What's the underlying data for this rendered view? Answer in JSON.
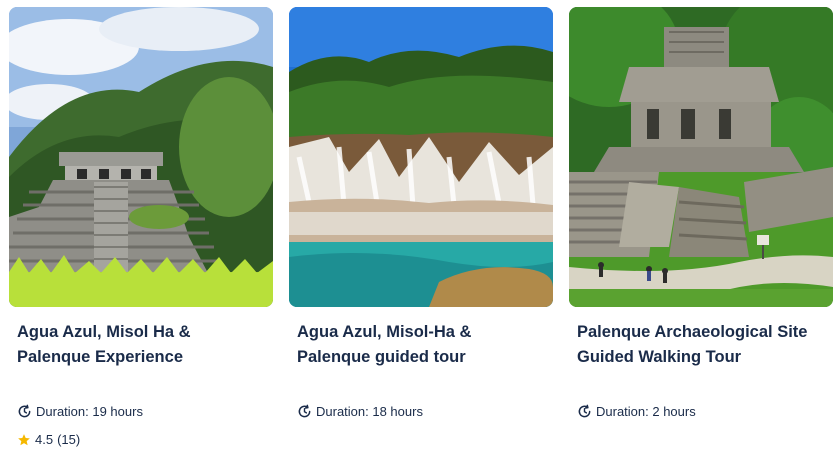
{
  "cards": [
    {
      "image_alt": "Palenque pyramid temple with jungle",
      "title": "Agua Azul, Misol Ha & Palenque Experience",
      "duration": "Duration: 19 hours",
      "rating": "4.5",
      "reviews": "(15)"
    },
    {
      "image_alt": "Agua Azul turquoise waterfalls",
      "title": "Agua Azul, Misol-Ha & Palenque guided tour",
      "duration": "Duration: 18 hours"
    },
    {
      "image_alt": "Palenque archaeological site with temple and walkers",
      "title": "Palenque Archaeological Site Guided Walking Tour",
      "duration": "Duration: 2 hours"
    }
  ],
  "colors": {
    "title": "#1a2b49",
    "star": "#f5b800"
  },
  "icons": {
    "duration": "clock-refresh-icon",
    "rating": "star-icon"
  }
}
